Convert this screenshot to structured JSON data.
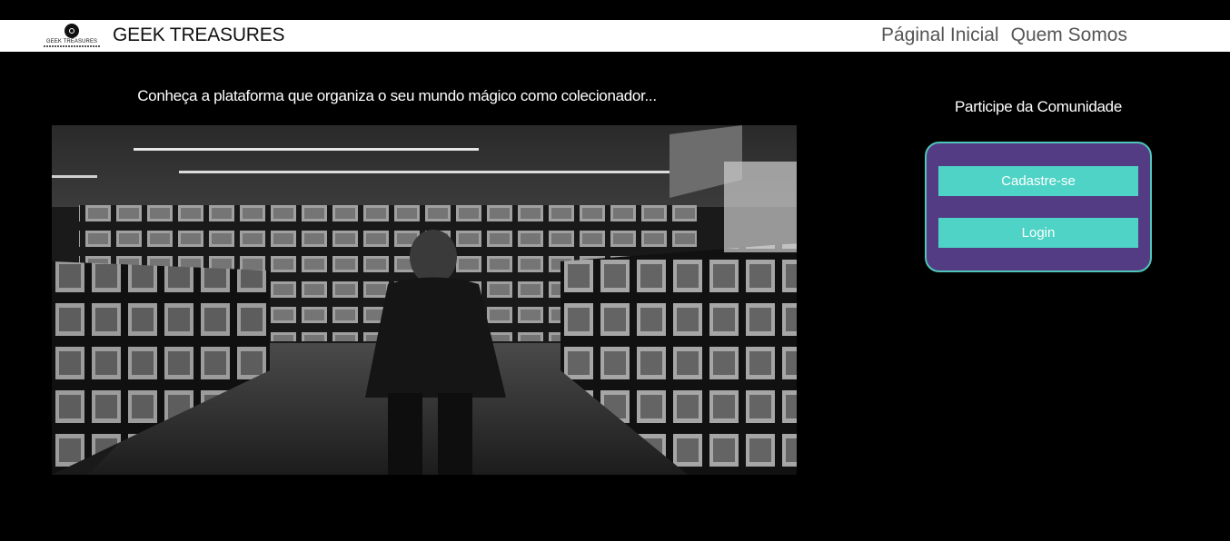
{
  "header": {
    "logo_text": "GEEK TREASURES",
    "brand": "GEEK TREASURES",
    "nav": [
      {
        "label": "Páginal Inicial"
      },
      {
        "label": "Quem Somos"
      }
    ]
  },
  "main": {
    "intro": "Conheça a plataforma que organiza o seu mundo mágico como colecionador..."
  },
  "sidebar": {
    "title": "Participe da Comunidade",
    "signup_label": "Cadastre-se",
    "login_label": "Login"
  },
  "colors": {
    "background": "#000000",
    "header": "#ffffff",
    "card": "#533c84",
    "card_border": "#4fc6b8",
    "button": "#4ed3c6"
  }
}
